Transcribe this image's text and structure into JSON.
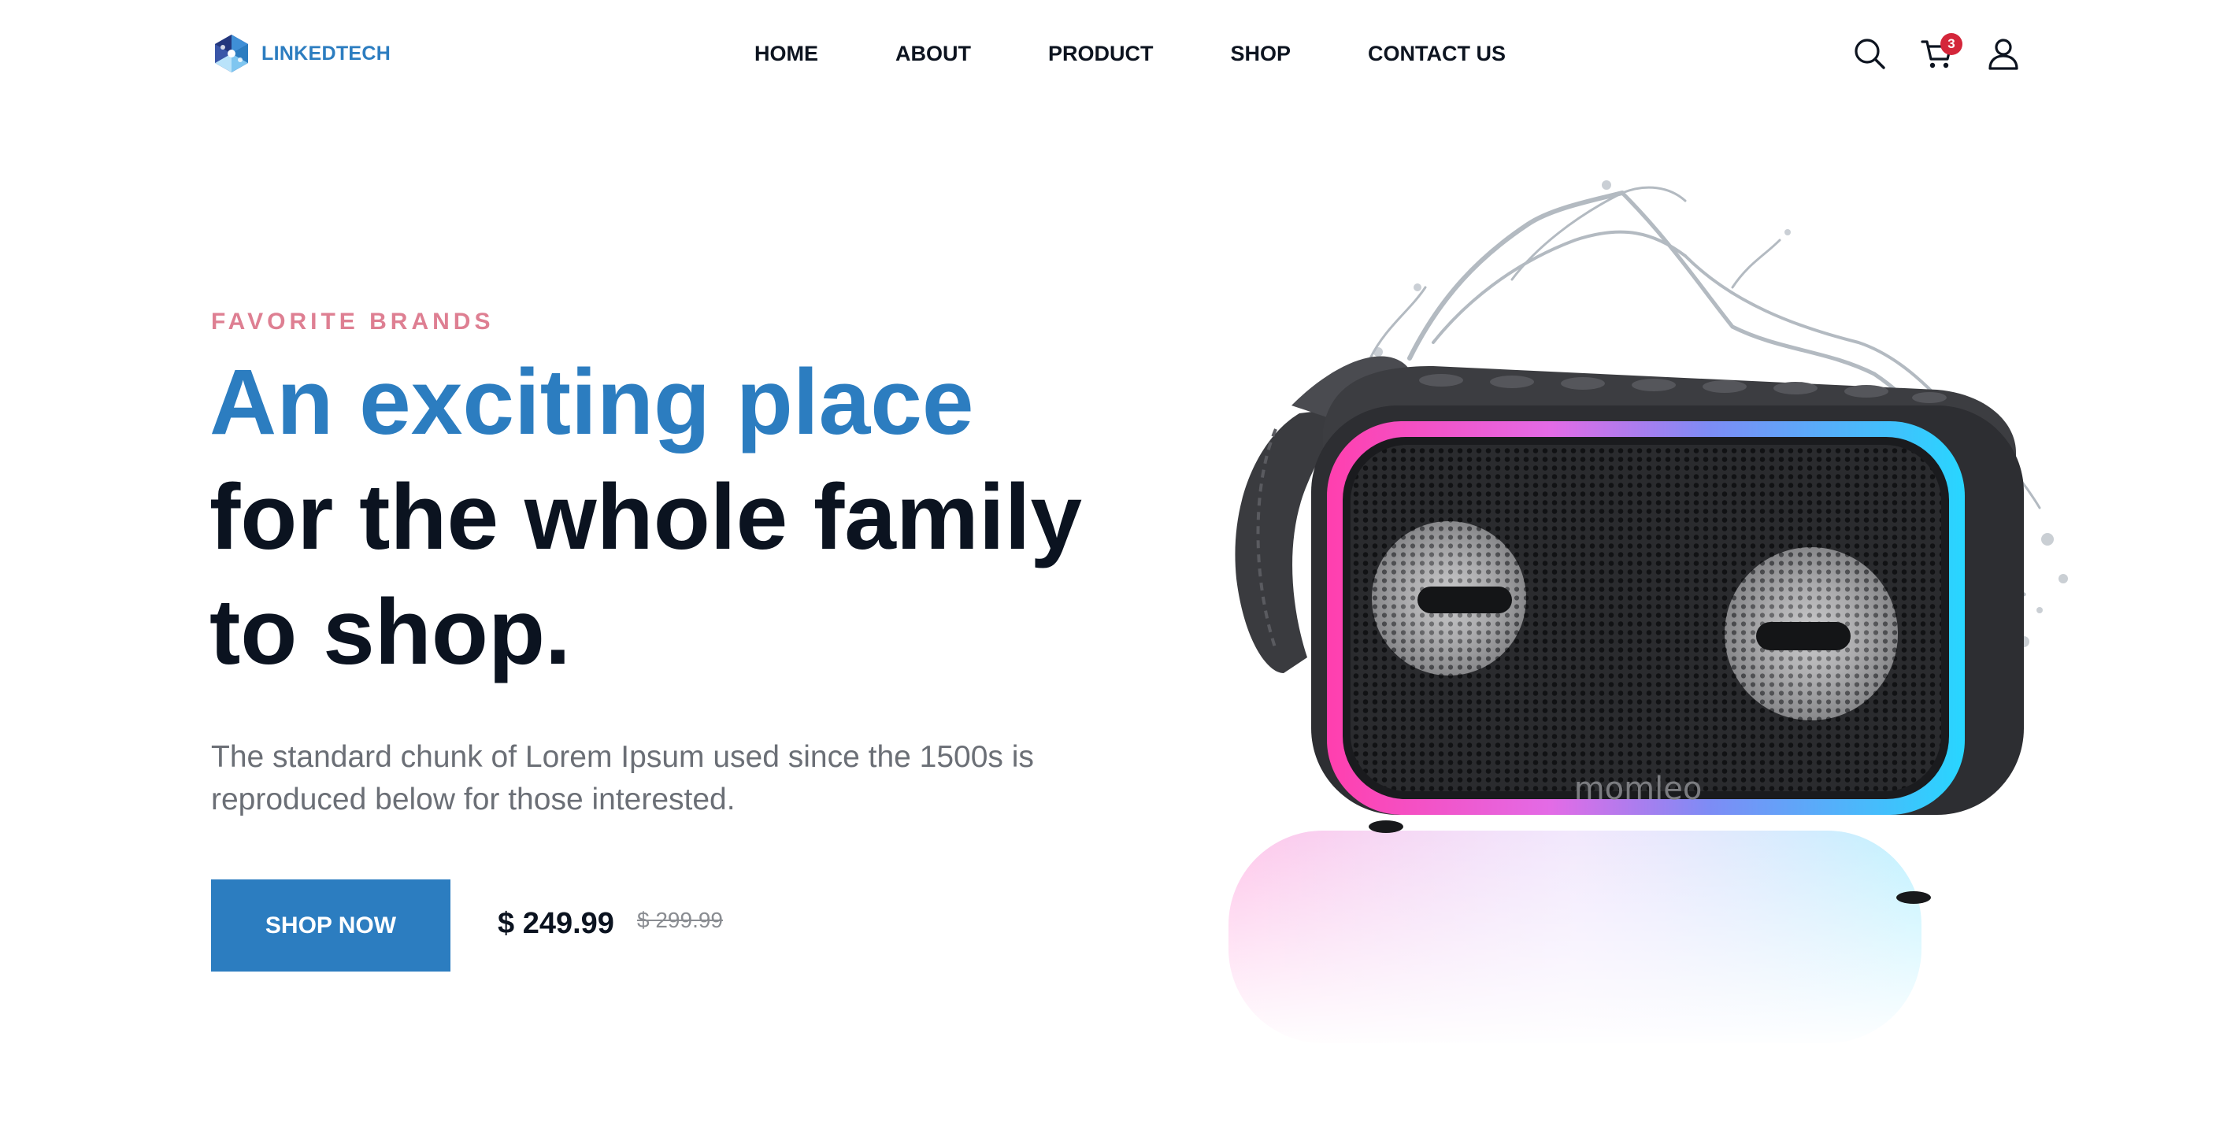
{
  "brand": {
    "name": "LINKEDTECH"
  },
  "nav": {
    "items": [
      {
        "label": "HOME"
      },
      {
        "label": "ABOUT"
      },
      {
        "label": "PRODUCT"
      },
      {
        "label": "SHOP"
      },
      {
        "label": "CONTACT US"
      }
    ]
  },
  "header_icons": {
    "search": "search-icon",
    "cart": "cart-icon",
    "cart_count": "3",
    "account": "user-icon"
  },
  "hero": {
    "eyebrow": "FAVORITE BRANDS",
    "headline_line1": "An exciting place",
    "headline_line2": "for the whole family",
    "headline_line3": "to shop.",
    "description": "The standard chunk of Lorem Ipsum used since the 1500s is reproduced below for those interested.",
    "cta_label": "SHOP NOW",
    "price": "$ 249.99",
    "old_price": "$ 299.99",
    "product_brand": "momleo"
  },
  "colors": {
    "accent": "#2c7dc0",
    "eyebrow": "#de7f92",
    "headline": "#0b1320",
    "badge": "#d4263a"
  }
}
